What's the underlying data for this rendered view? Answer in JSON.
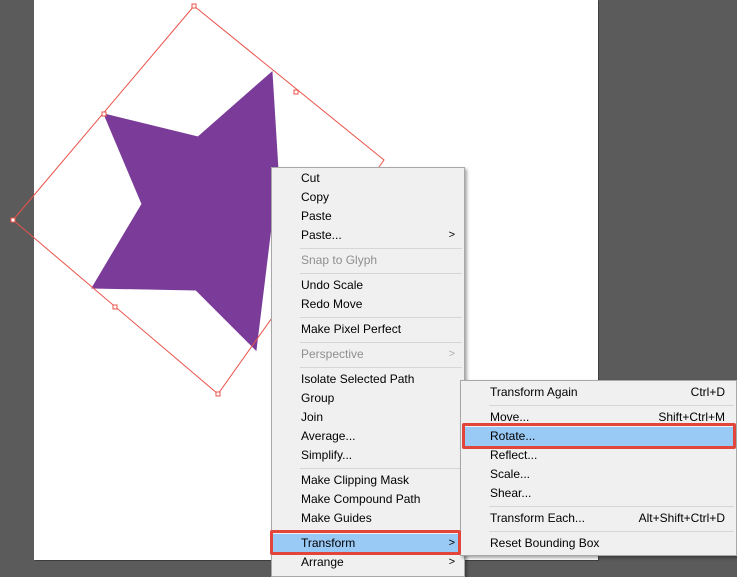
{
  "colors": {
    "workspace": "#5b5b5b",
    "artboard": "#ffffff",
    "star_fill": "#7b3c99",
    "bounding_box": "#e8534a",
    "menu_bg": "#f0f0f0",
    "highlight": "#99c9f5",
    "callout": "#e2463b"
  },
  "context_menu": {
    "items": [
      {
        "label": "Cut"
      },
      {
        "label": "Copy"
      },
      {
        "label": "Paste"
      },
      {
        "label": "Paste..."
      },
      {
        "label": "Snap to Glyph"
      },
      {
        "label": "Undo Scale"
      },
      {
        "label": "Redo Move"
      },
      {
        "label": "Make Pixel Perfect"
      },
      {
        "label": "Perspective"
      },
      {
        "label": "Isolate Selected Path"
      },
      {
        "label": "Group"
      },
      {
        "label": "Join"
      },
      {
        "label": "Average..."
      },
      {
        "label": "Simplify..."
      },
      {
        "label": "Make Clipping Mask"
      },
      {
        "label": "Make Compound Path"
      },
      {
        "label": "Make Guides"
      },
      {
        "label": "Transform"
      },
      {
        "label": "Arrange"
      }
    ],
    "submenu_arrow": ">"
  },
  "transform_submenu": {
    "items": [
      {
        "label": "Transform Again",
        "shortcut": "Ctrl+D"
      },
      {
        "label": "Move...",
        "shortcut": "Shift+Ctrl+M"
      },
      {
        "label": "Rotate...",
        "shortcut": ""
      },
      {
        "label": "Reflect...",
        "shortcut": ""
      },
      {
        "label": "Scale...",
        "shortcut": ""
      },
      {
        "label": "Shear...",
        "shortcut": ""
      },
      {
        "label": "Transform Each...",
        "shortcut": "Alt+Shift+Ctrl+D"
      },
      {
        "label": "Reset Bounding Box",
        "shortcut": ""
      }
    ]
  }
}
